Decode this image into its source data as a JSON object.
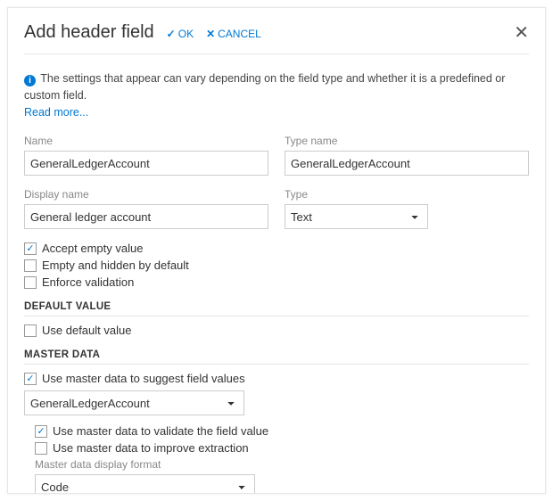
{
  "header": {
    "title": "Add header field",
    "ok": "OK",
    "cancel": "CANCEL"
  },
  "info": {
    "text": "The settings that appear can vary depending on the field type and whether it is a predefined or custom field.",
    "read_more": "Read more..."
  },
  "labels": {
    "name": "Name",
    "type_name": "Type name",
    "display_name": "Display name",
    "type": "Type",
    "master_data_display_format": "Master data display format"
  },
  "values": {
    "name": "GeneralLedgerAccount",
    "type_name": "GeneralLedgerAccount",
    "display_name": "General ledger account",
    "type": "Text",
    "master_data_source": "GeneralLedgerAccount",
    "master_data_display_format": "Code"
  },
  "checkboxes": {
    "accept_empty": "Accept empty value",
    "empty_hidden": "Empty and hidden by default",
    "enforce_validation": "Enforce validation",
    "use_default": "Use default value",
    "use_master_suggest": "Use master data to suggest field values",
    "use_master_validate": "Use master data to validate the field value",
    "use_master_extract": "Use master data to improve extraction"
  },
  "sections": {
    "default_value": "DEFAULT VALUE",
    "master_data": "MASTER DATA"
  }
}
